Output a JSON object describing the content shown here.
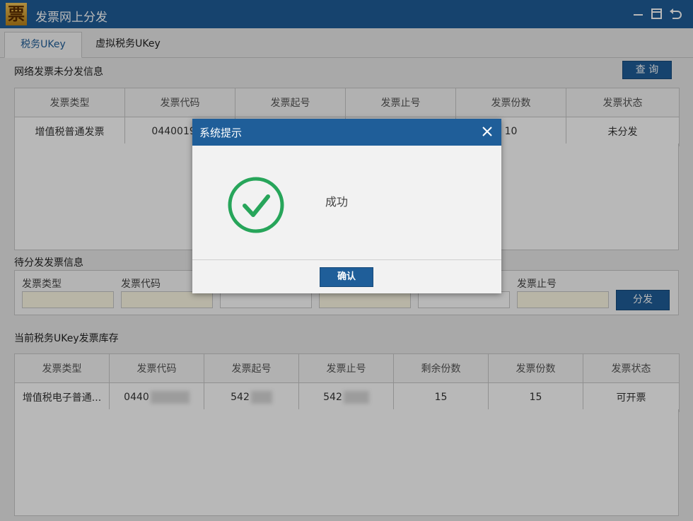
{
  "window": {
    "logo_char": "票",
    "title": "发票网上分发"
  },
  "tabs": [
    {
      "label": "税务UKey"
    },
    {
      "label": "虚拟税务UKey"
    }
  ],
  "undistributed": {
    "title": "网络发票未分发信息",
    "query_label": "查 询",
    "columns": [
      "发票类型",
      "发票代码",
      "发票起号",
      "发票止号",
      "发票份数",
      "发票状态"
    ],
    "rows": [
      {
        "type": "增值税普通发票",
        "code": "044001906",
        "start": "",
        "end": "",
        "count": "10",
        "status": "未分发"
      }
    ]
  },
  "pending": {
    "title": "待分发发票信息",
    "labels": [
      "发票类型",
      "发票代码",
      "",
      "",
      "",
      "发票止号"
    ],
    "distribute_label": "分发"
  },
  "inventory": {
    "title": "当前税务UKey发票库存",
    "columns": [
      "发票类型",
      "发票代码",
      "发票起号",
      "发票止号",
      "剩余份数",
      "发票份数",
      "发票状态"
    ],
    "rows": [
      {
        "type": "增值税电子普通...",
        "code": "0440",
        "start": "542",
        "end": "542",
        "remaining": "15",
        "count": "15",
        "status": "可开票"
      }
    ]
  },
  "dialog": {
    "title": "系统提示",
    "message": "成功",
    "ok_label": "确认",
    "icon": "success-check-icon",
    "accent_color": "#27a55a"
  }
}
